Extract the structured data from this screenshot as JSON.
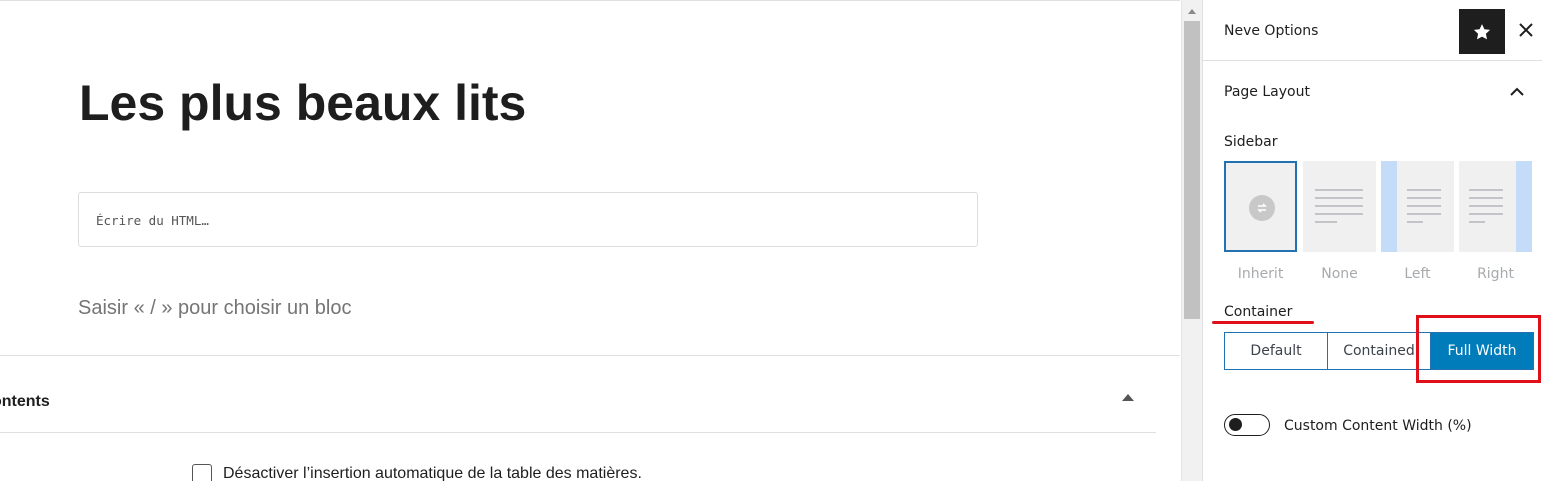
{
  "editor": {
    "post_title": "Les plus beaux lits",
    "html_block_placeholder": "Écrire du HTML…",
    "block_appender": "Saisir « / » pour choisir un bloc"
  },
  "toc_panel": {
    "title": "ontents",
    "option_label": "Désactiver l’insertion automatique de la table des matières.",
    "option_checked": false
  },
  "sidebar": {
    "title": "Neve Options",
    "star_icon": "star-icon",
    "close_icon": "close-icon",
    "section_title": "Page Layout",
    "sidebar_label": "Sidebar",
    "sidebar_options": [
      {
        "label": "Inherit",
        "selected": true
      },
      {
        "label": "None",
        "selected": false
      },
      {
        "label": "Left",
        "selected": false
      },
      {
        "label": "Right",
        "selected": false
      }
    ],
    "container_label": "Container",
    "container_options": [
      {
        "label": "Default",
        "active": false
      },
      {
        "label": "Contained",
        "active": false
      },
      {
        "label": "Full Width",
        "active": true
      }
    ],
    "custom_width_label": "Custom Content Width (%)",
    "custom_width_enabled": false
  },
  "colors": {
    "accent": "#007cba",
    "selected_border": "#2271b1",
    "annotation_red": "#e0101b"
  }
}
